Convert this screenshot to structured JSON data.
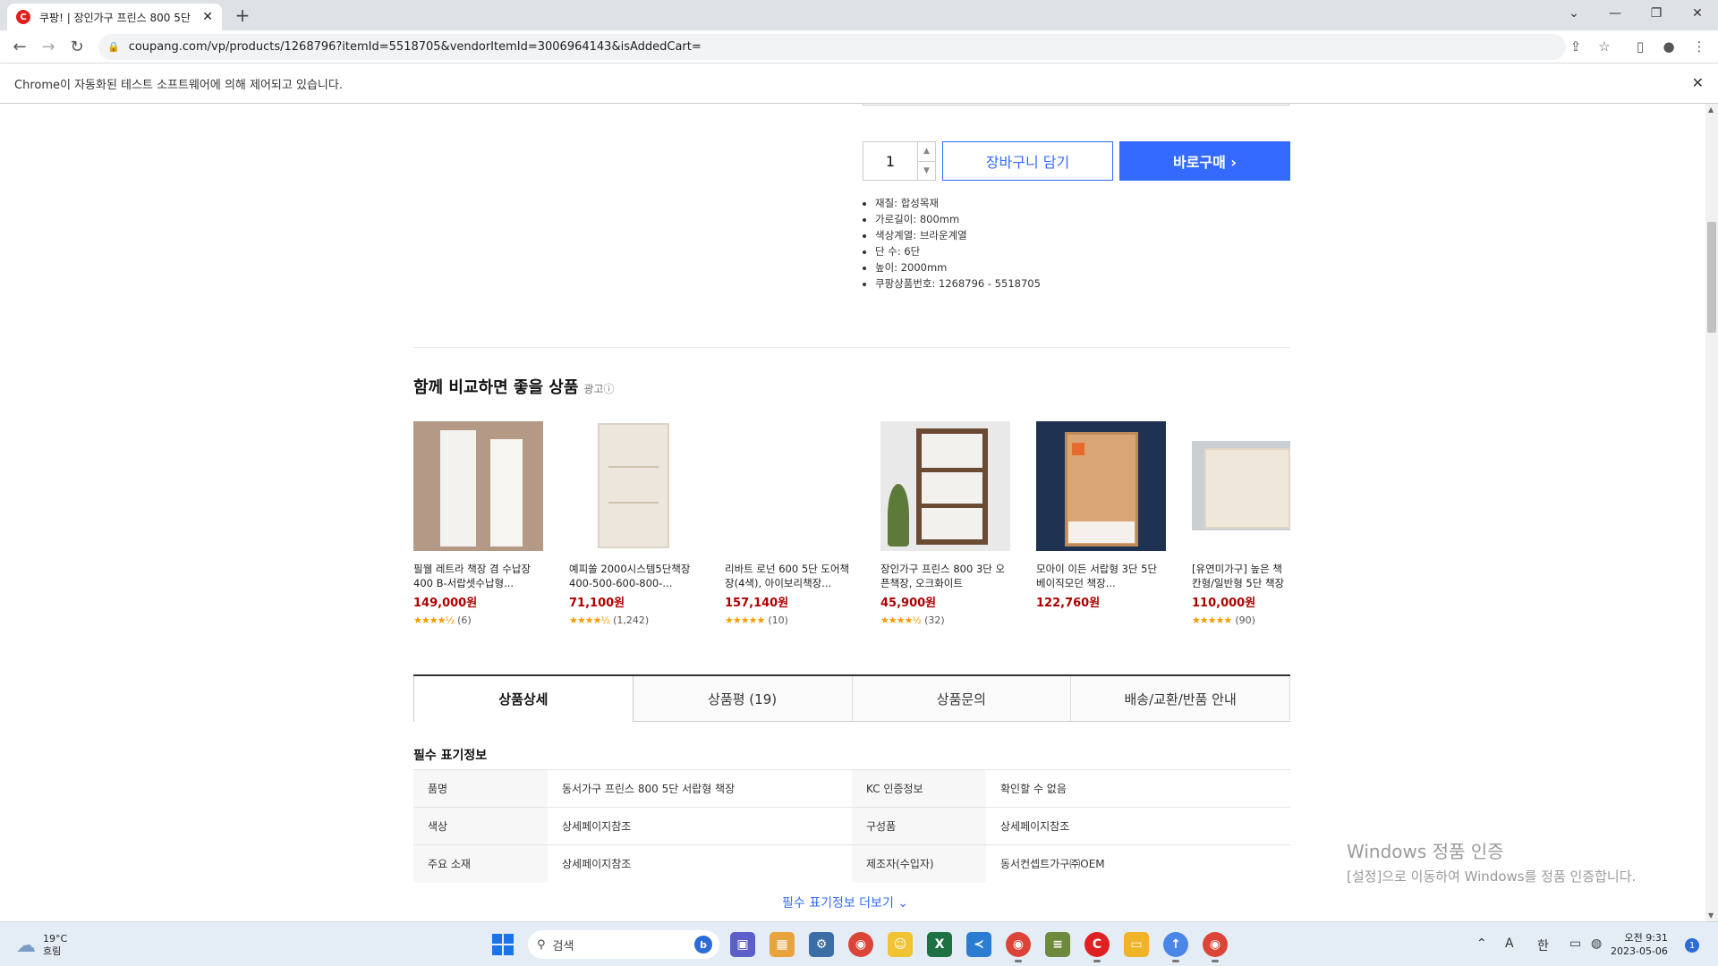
{
  "browser": {
    "tab_title": "쿠팡! | 장인가구 프린스 800 5단",
    "favicon_letter": "C",
    "url": "coupang.com/vp/products/1268796?itemId=5518705&vendorItemId=3006964143&isAddedCart=",
    "automation_notice": "Chrome이 자동화된 테스트 소프트웨어에 의해 제어되고 있습니다."
  },
  "purchase": {
    "quantity": "1",
    "cart_label": "장바구니 담기",
    "buy_label": "바로구매 ›"
  },
  "specs": [
    "재질: 합성목재",
    "가로길이: 800mm",
    "색상계열: 브라운계열",
    "단 수: 6단",
    "높이: 2000mm",
    "쿠팡상품번호: 1268796 - 5518705"
  ],
  "compare": {
    "title": "함께 비교하면 좋을 상품",
    "ad_label": "광고ⓘ",
    "products": [
      {
        "name": "필웰 레트라 책장 겸 수납장400 B-서랍셋수납형...",
        "price": "149,000원",
        "stars": "★★★★½",
        "reviews": "(6)"
      },
      {
        "name": "예피쏠 2000시스템5단책장 400-500-600-800-...",
        "price": "71,100원",
        "stars": "★★★★½",
        "reviews": "(1,242)"
      },
      {
        "name": "리바트 로넌 600 5단 도어책장(4색), 아이보리책장...",
        "price": "157,140원",
        "stars": "★★★★★",
        "reviews": "(10)"
      },
      {
        "name": "장인가구 프린스 800 3단 오픈책장, 오크화이트",
        "price": "45,900원",
        "stars": "★★★★½",
        "reviews": "(32)"
      },
      {
        "name": "모아이 이든 서랍형 3단 5단 베이직모던 책장...",
        "price": "122,760원",
        "stars": "★★★★★",
        "reviews": ""
      },
      {
        "name": "[유연미가구] 높은 책 칸형/일반형 5단 책장",
        "price": "110,000원",
        "stars": "★★★★★",
        "reviews": "(90)"
      }
    ]
  },
  "detail_tabs": [
    "상품상세",
    "상품평 (19)",
    "상품문의",
    "배송/교환/반품 안내"
  ],
  "required_info": {
    "title": "필수 표기정보",
    "rows": [
      {
        "k1": "품명",
        "v1": "동서가구 프린스 800 5단 서랍형 책장",
        "k2": "KC 인증정보",
        "v2": "확인할 수 없음"
      },
      {
        "k1": "색상",
        "v1": "상세페이지참조",
        "k2": "구성품",
        "v2": "상세페이지참조"
      },
      {
        "k1": "주요 소재",
        "v1": "상세페이지참조",
        "k2": "제조자(수입자)",
        "v2": "동서컨셉트가구㈜OEM"
      }
    ],
    "more_label": "필수 표기정보 더보기 ⌄"
  },
  "watermark": {
    "line1": "Windows 정품 인증",
    "line2": "[설정]으로 이동하여 Windows를 정품 인증합니다."
  },
  "taskbar": {
    "temp": "19°C",
    "weather": "흐림",
    "search_placeholder": "검색",
    "ime1": "A",
    "ime2": "한",
    "time": "오전 9:31",
    "date": "2023-05-06",
    "notification_count": "1"
  },
  "colors": {
    "accent": "#346aff",
    "price": "#ae0000",
    "star": "#f59b00"
  }
}
